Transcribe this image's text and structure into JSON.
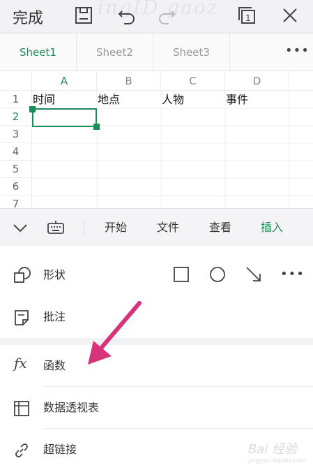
{
  "toolbar": {
    "done_label": "完成",
    "sheet_count": "1",
    "watermark": "ingID gaoz"
  },
  "sheets": {
    "tabs": [
      {
        "label": "Sheet1",
        "active": true
      },
      {
        "label": "Sheet2",
        "active": false
      },
      {
        "label": "Sheet3",
        "active": false
      }
    ],
    "more_label": "•••"
  },
  "grid": {
    "columns": [
      "A",
      "B",
      "C",
      "D"
    ],
    "rows": [
      "1",
      "2",
      "3",
      "4",
      "5",
      "6",
      "7"
    ],
    "active_column": "A",
    "active_row": "2",
    "cells": {
      "A1": "时间",
      "B1": "地点",
      "C1": "人物",
      "D1": "事件"
    }
  },
  "menubar": {
    "tabs": [
      {
        "label": "开始",
        "active": false
      },
      {
        "label": "文件",
        "active": false
      },
      {
        "label": "查看",
        "active": false
      },
      {
        "label": "插入",
        "active": true
      }
    ]
  },
  "insert_panel": {
    "items": [
      {
        "label": "形状",
        "icon": "shape-icon"
      },
      {
        "label": "批注",
        "icon": "comment-icon"
      },
      {
        "label": "函数",
        "icon": "function-icon"
      },
      {
        "label": "数据透视表",
        "icon": "pivot-table-icon"
      },
      {
        "label": "超链接",
        "icon": "hyperlink-icon"
      }
    ],
    "shape_more_label": "•••"
  },
  "colors": {
    "accent": "#1e8c5a",
    "arrow": "#d6337a"
  },
  "watermark_bottom": {
    "brand": "Bai 经验",
    "url": "jingyan.baidu.com"
  }
}
